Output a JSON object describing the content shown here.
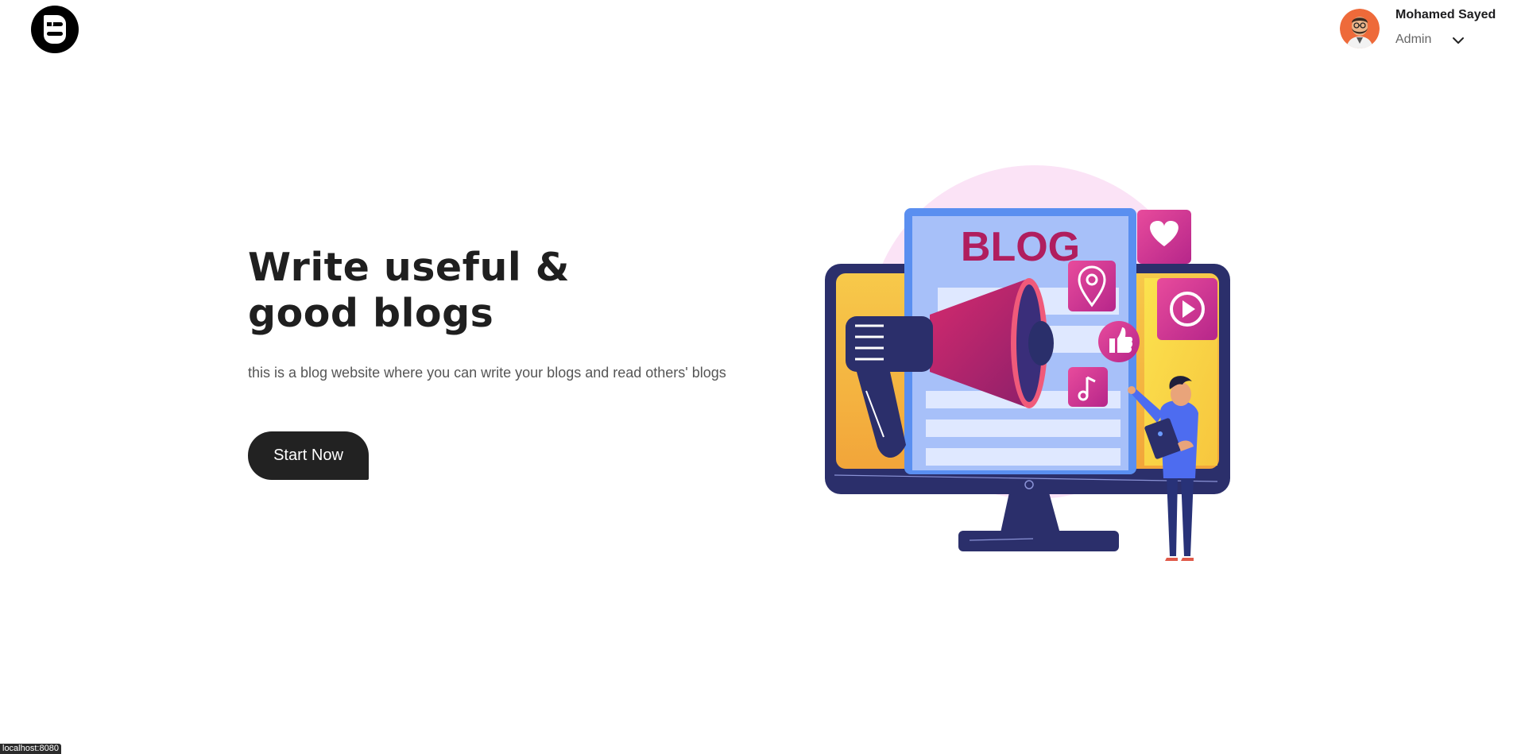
{
  "header": {
    "logo_name": "blogger-logo",
    "user": {
      "name": "Mohamed Sayed",
      "role": "Admin"
    }
  },
  "hero": {
    "title": "Write useful & good blogs",
    "description": "this is a blog website where you can write your blogs and read others' blogs",
    "cta_label": "Start Now",
    "illustration_text": "BLOG"
  },
  "status_bar": {
    "url": "localhost:8080"
  },
  "colors": {
    "primary_dark": "#222222",
    "accent_pink": "#d6307a",
    "accent_blue": "#5a7bf2",
    "monitor_navy": "#2b2f6b",
    "blob_pink": "#f9e1f6"
  }
}
